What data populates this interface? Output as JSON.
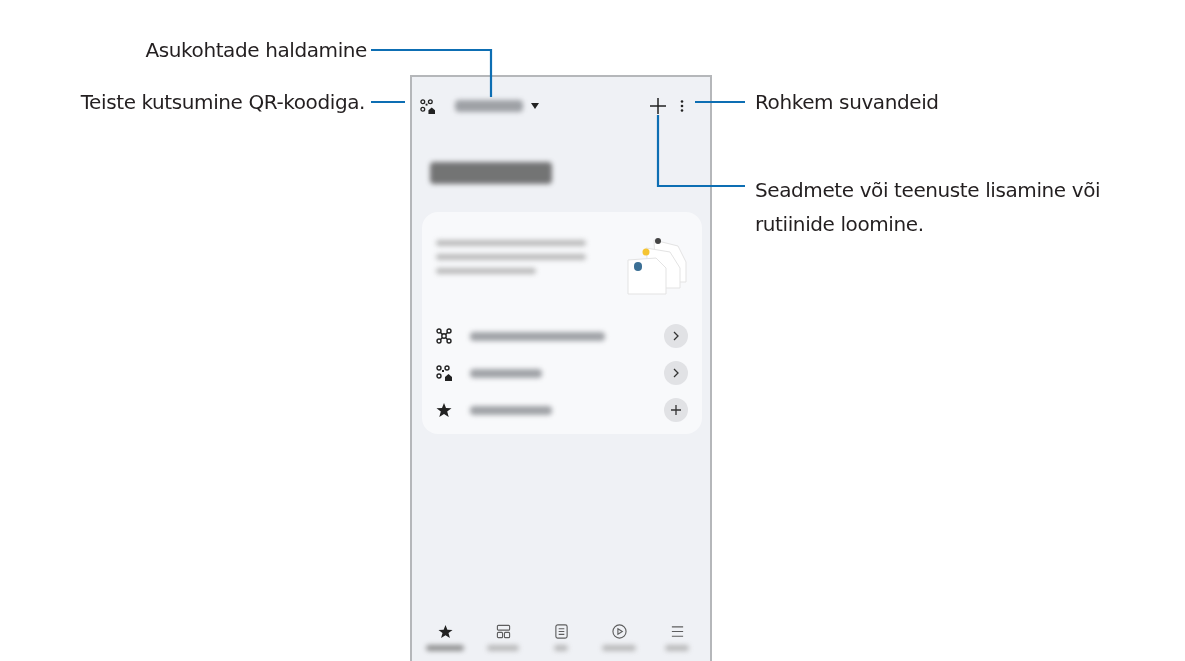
{
  "callouts": [
    {
      "text": "Asukohtade haldamine",
      "kind": "location"
    },
    {
      "text": "Teiste kutsumine QR-koodiga.",
      "kind": "qr"
    },
    {
      "text": "Rohkem suvandeid",
      "kind": "more"
    },
    {
      "text": "Seadmete või teenuste lisamine või rutiinide loomine.",
      "kind": "add"
    }
  ],
  "phone": {
    "card_rows": [
      {
        "kind": "hub",
        "button": {
          "kind": "chevron"
        }
      },
      {
        "kind": "qr",
        "button": {
          "kind": "chevron"
        }
      },
      {
        "kind": "star",
        "button": {
          "kind": "plus"
        }
      }
    ],
    "nav": [
      {
        "kind": "star",
        "selected": true
      },
      {
        "kind": "grid",
        "selected": false
      },
      {
        "kind": "doc",
        "selected": false
      },
      {
        "kind": "play",
        "selected": false
      },
      {
        "kind": "menu",
        "selected": false
      }
    ]
  }
}
